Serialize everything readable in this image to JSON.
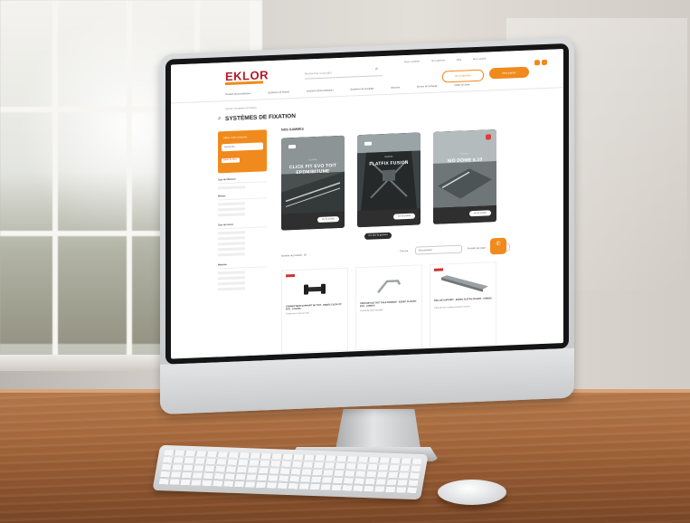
{
  "site": {
    "logo": "EKLOR",
    "search_placeholder": "Rechercher un produit",
    "util_links": [
      "Nous contacter",
      "Nos agences",
      "Blog",
      "Mon compte"
    ],
    "account_button": "Se connecter",
    "cart_button": "Mon panier",
    "nav": [
      "Produits photovoltaïques",
      "Systèmes de fixation",
      "Solutions photovoltaïques",
      "Systèmes de stockage",
      "Services",
      "Bornes de recharge",
      "Outils de vente"
    ]
  },
  "page": {
    "breadcrumb": "Accueil / Systèmes de fixation",
    "title": "SYSTÈMES DE FIXATION"
  },
  "sidebar": {
    "filter_title": "Affiner votre recherche",
    "filter_input": "Recherche",
    "filter_chip": "Effacer les filtres",
    "facets": [
      "Type de bâtiment",
      "Marque",
      "Type de toiture",
      "Matériau"
    ]
  },
  "featured": {
    "title": "NOS GAMMES",
    "cards": [
      {
        "label": "Gamme",
        "name": "CLICK FIT EVO TOIT EPDM/BITUME",
        "button": "Voir les produits",
        "tag": ""
      },
      {
        "label": "Gamme",
        "name": "FLATFIX FUSION",
        "button": "Voir les produits",
        "tag": ""
      },
      {
        "label": "Gamme",
        "name": "SIO DOME 6.10",
        "button": "Voir les produits",
        "tag": ""
      }
    ],
    "more_button": "Voir plus de gammes"
  },
  "listing": {
    "results": "Nombre de produits : 45",
    "sort_label": "Trier par",
    "sort_value": "Plus pertinent",
    "perpage_label": "Produits par page",
    "perpage_value": "24",
    "products": [
      {
        "name": "CONNECTEUR SUPPORT DE TOIT - ESDEC CLICK FIT EVO - 1012025",
        "sub": "Fixation pour toiture en tuile"
      },
      {
        "name": "CROCHET DE TOIT TUILE ROMANE - ESDEC CLICKFIT EVO - 1008070",
        "sub": "Crochet de toiture ajustable"
      },
      {
        "name": "RAIL DE SUPPORT - ESDEC FLATFIX FUSION - 1008025",
        "sub": "Pièce de base systèmes de fixation toit plat"
      }
    ]
  },
  "fab_label": "Contact"
}
